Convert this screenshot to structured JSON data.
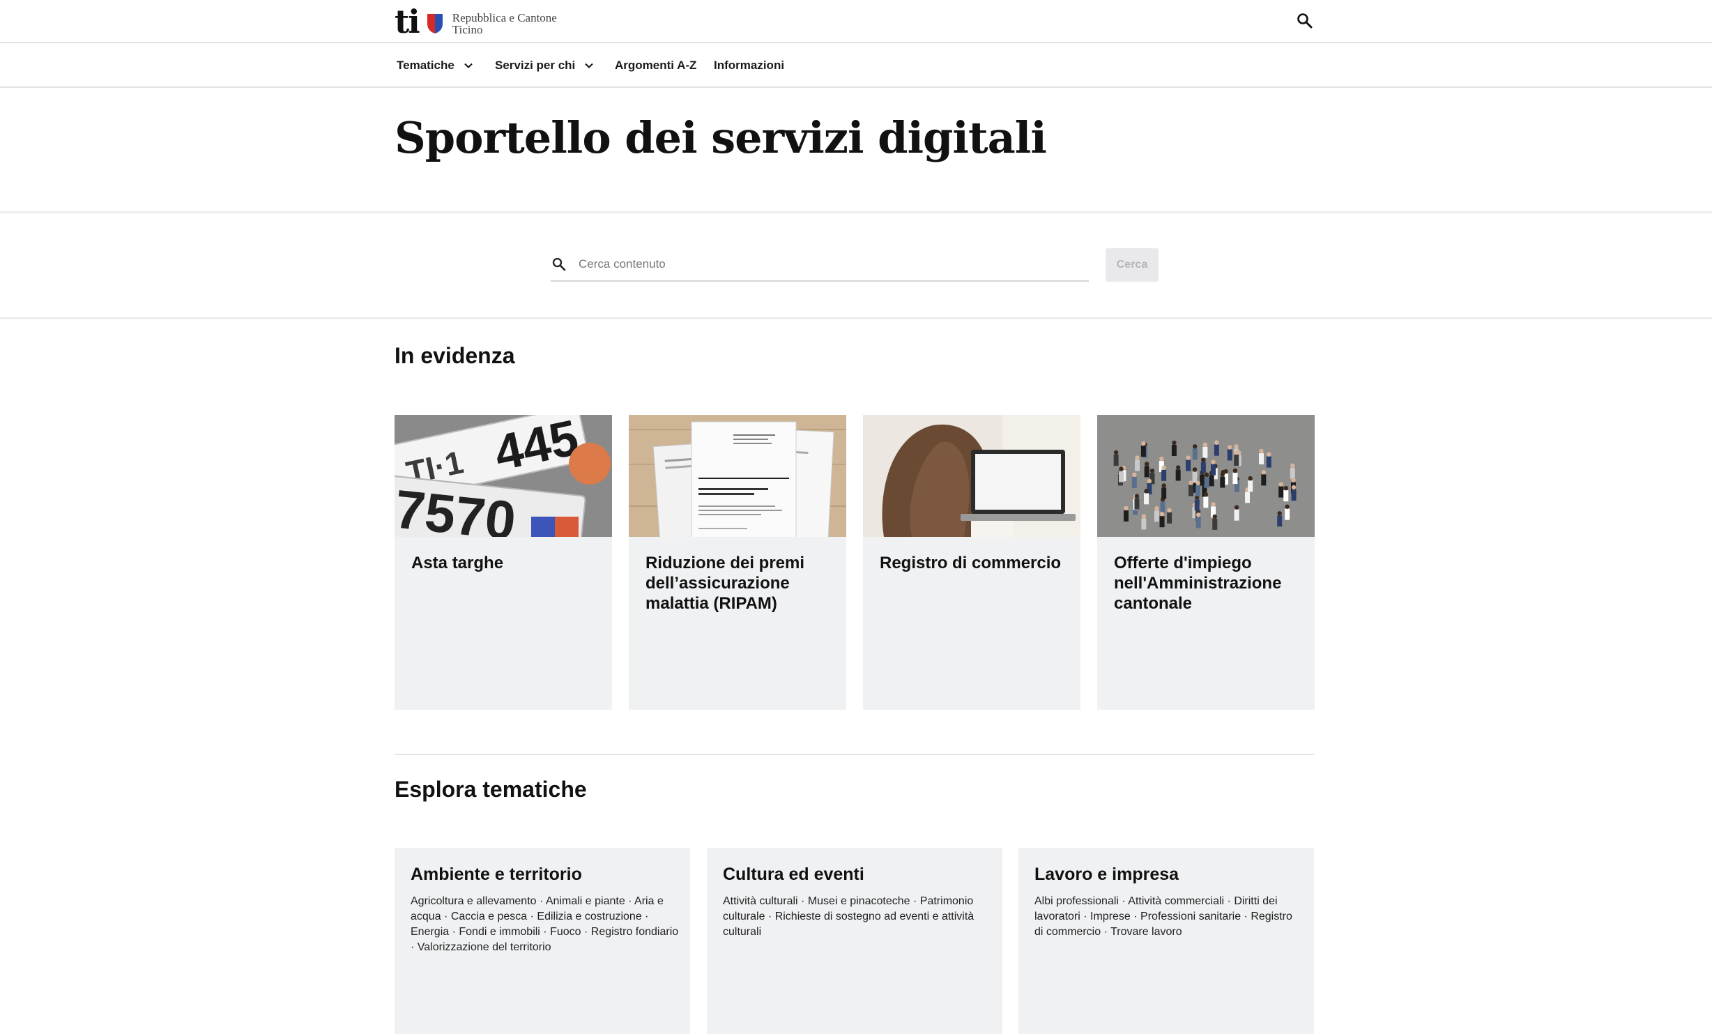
{
  "header": {
    "logo_mark": "ti",
    "logo_line1": "Repubblica e Cantone",
    "logo_line2": "Ticino",
    "search_icon": "search-icon"
  },
  "nav": {
    "items": [
      {
        "label": "Tematiche",
        "has_dropdown": true
      },
      {
        "label": "Servizi per chi",
        "has_dropdown": true
      },
      {
        "label": "Argomenti A-Z",
        "has_dropdown": false
      },
      {
        "label": "Informazioni",
        "has_dropdown": false
      }
    ]
  },
  "page": {
    "title": "Sportello dei servizi digitali"
  },
  "search": {
    "placeholder": "Cerca contenuto",
    "value": "",
    "button_label": "Cerca"
  },
  "featured": {
    "heading": "In evidenza",
    "cards": [
      {
        "title": "Asta targhe",
        "image": "license-plates-photo"
      },
      {
        "title": "Riduzione dei premi dell’assicurazione malattia (RIPAM)",
        "image": "documents-photo"
      },
      {
        "title": "Registro di commercio",
        "image": "woman-laptop-photo"
      },
      {
        "title": "Offerte d'impiego nell'Amministrazione cantonale",
        "image": "group-photo"
      }
    ]
  },
  "topics": {
    "heading": "Esplora tematiche",
    "items": [
      {
        "title": "Ambiente e territorio",
        "description": "Agricoltura e allevamento · Animali e piante · Aria e acqua · Caccia e pesca · Edilizia e costruzione · Energia · Fondi e immobili · Fuoco · Registro fondiario · Valorizzazione del territorio"
      },
      {
        "title": "Cultura ed eventi",
        "description": "Attività culturali · Musei e pinacoteche · Patrimonio culturale · Richieste di sostegno ad eventi e attività culturali"
      },
      {
        "title": "Lavoro e impresa",
        "description": "Albi professionali · Attività commerciali · Diritti dei lavoratori · Imprese · Professioni sanitarie · Registro di commercio · Trovare lavoro"
      }
    ]
  },
  "colors": {
    "card_background": "#f0f1f3",
    "divider": "#e3e3e3",
    "shield_red": "#d62a26",
    "shield_blue": "#2a4fb3"
  }
}
